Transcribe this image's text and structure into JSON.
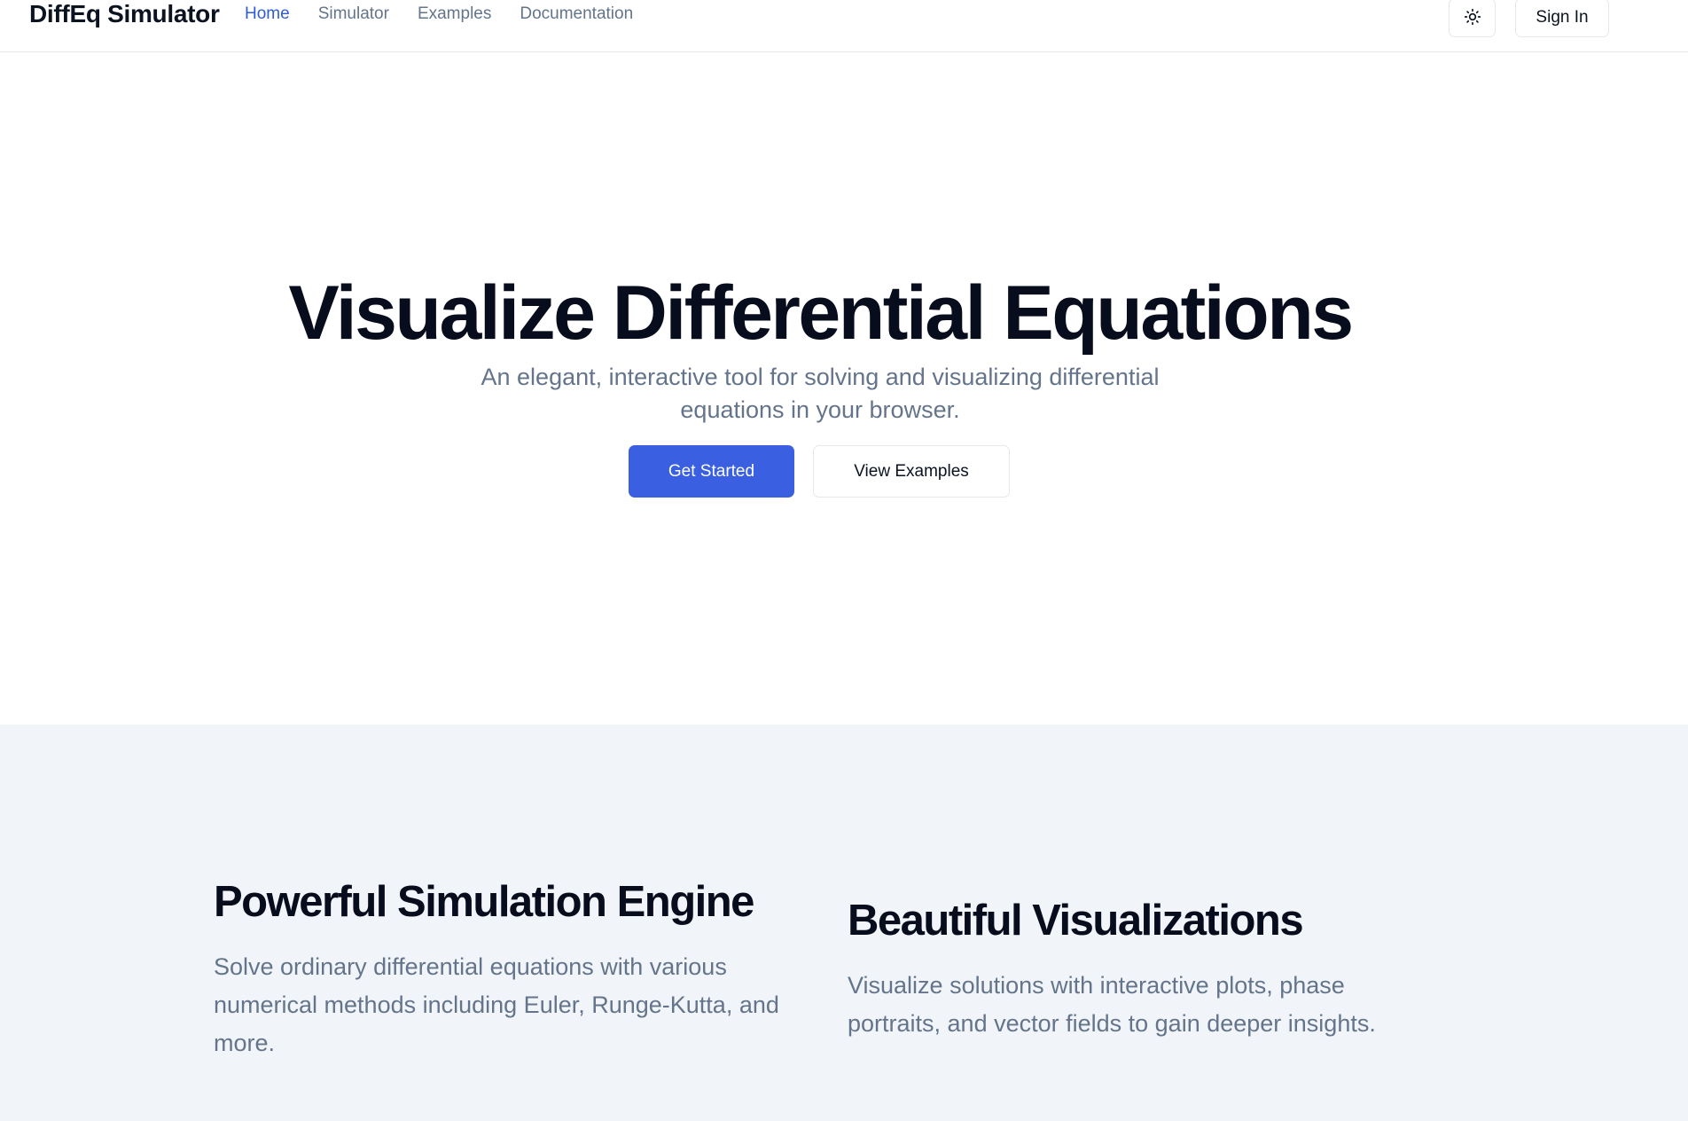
{
  "header": {
    "brand": "DiffEq Simulator",
    "nav": [
      "Home",
      "Simulator",
      "Examples",
      "Documentation"
    ],
    "active_nav": "Home",
    "theme_icon": "sun-icon",
    "signin_label": "Sign In"
  },
  "hero": {
    "title": "Visualize Differential Equations",
    "subtitle": "An elegant, interactive tool for solving and visualizing differential equations in your browser.",
    "primary_label": "Get Started",
    "secondary_label": "View Examples"
  },
  "features": [
    {
      "title": "Powerful Simulation Engine",
      "description": "Solve ordinary differential equations with various numerical methods including Euler, Runge-Kutta, and more."
    },
    {
      "title": "Beautiful Visualizations",
      "description": "Visualize solutions with interactive plots, phase portraits, and vector fields to gain deeper insights."
    }
  ],
  "colors": {
    "accent": "#3a5fe0",
    "active_link": "#2f5bd8",
    "muted_text": "#64748b",
    "features_bg": "#f1f5f9"
  }
}
